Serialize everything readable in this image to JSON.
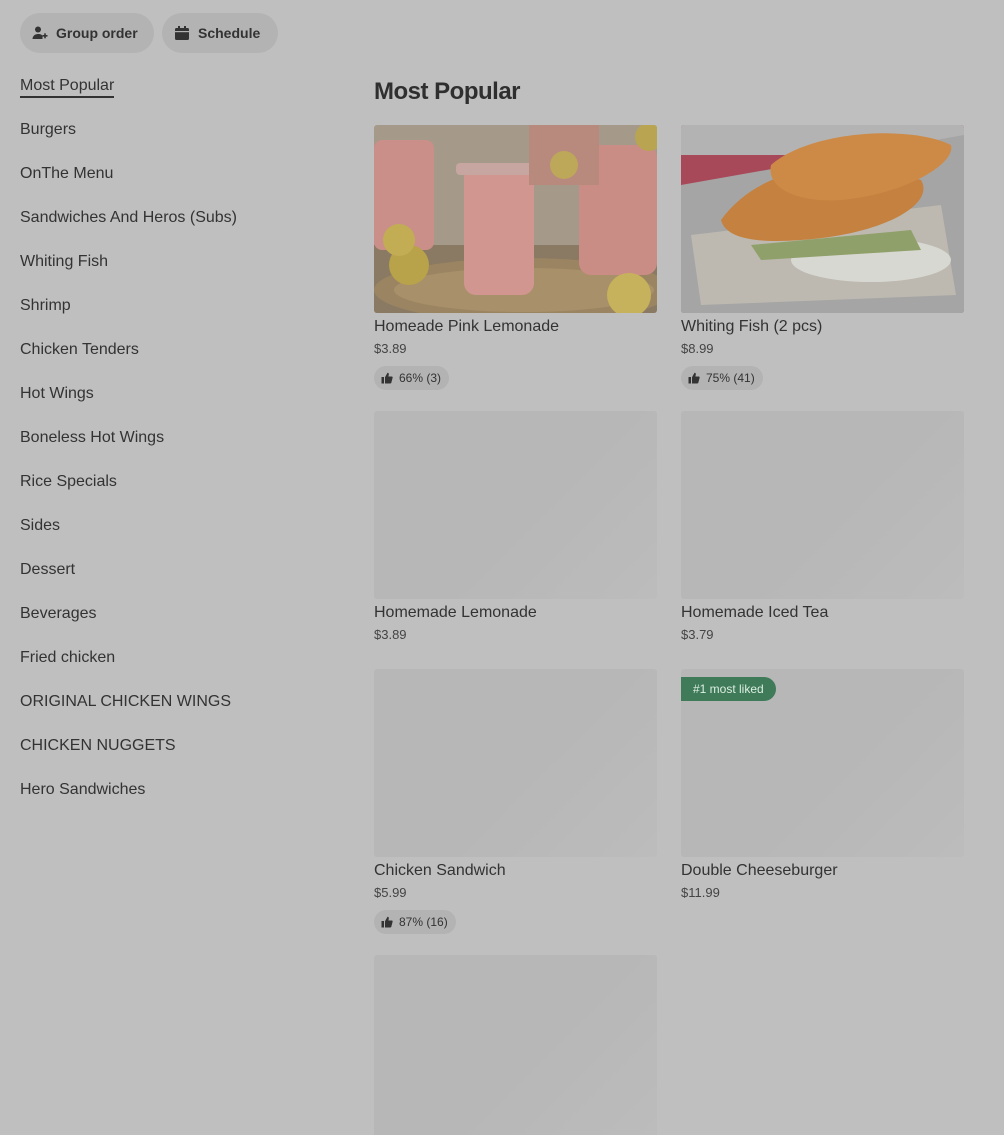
{
  "actions": {
    "group_order_label": "Group order",
    "schedule_label": "Schedule"
  },
  "sidebar": {
    "items": [
      {
        "label": "Most Popular"
      },
      {
        "label": "Burgers"
      },
      {
        "label": "OnThe Menu"
      },
      {
        "label": "Sandwiches And Heros (Subs)"
      },
      {
        "label": "Whiting Fish"
      },
      {
        "label": "Shrimp"
      },
      {
        "label": "Chicken Tenders"
      },
      {
        "label": "Hot Wings"
      },
      {
        "label": "Boneless Hot Wings"
      },
      {
        "label": "Rice Specials"
      },
      {
        "label": "Sides"
      },
      {
        "label": "Dessert"
      },
      {
        "label": "Beverages"
      },
      {
        "label": "Fried chicken"
      },
      {
        "label": "ORIGINAL CHICKEN WINGS"
      },
      {
        "label": "CHICKEN NUGGETS"
      },
      {
        "label": "Hero Sandwiches"
      }
    ]
  },
  "main": {
    "section_title": "Most Popular",
    "items": [
      {
        "name": "Homeade Pink Lemonade",
        "price": "$3.89",
        "rating": "66% (3)"
      },
      {
        "name": "Whiting Fish (2 pcs)",
        "price": "$8.99",
        "rating": "75% (41)"
      },
      {
        "name": "Homemade Lemonade",
        "price": "$3.89"
      },
      {
        "name": "Homemade Iced Tea",
        "price": "$3.79"
      },
      {
        "name": "Chicken Sandwich",
        "price": "$5.99",
        "rating": "87% (16)"
      },
      {
        "name": "Double Cheeseburger",
        "price": "$11.99",
        "badge": "#1 most liked"
      }
    ]
  },
  "colors": {
    "overlay_background": "#bfbfbf",
    "badge_green": "#3f7a59"
  }
}
